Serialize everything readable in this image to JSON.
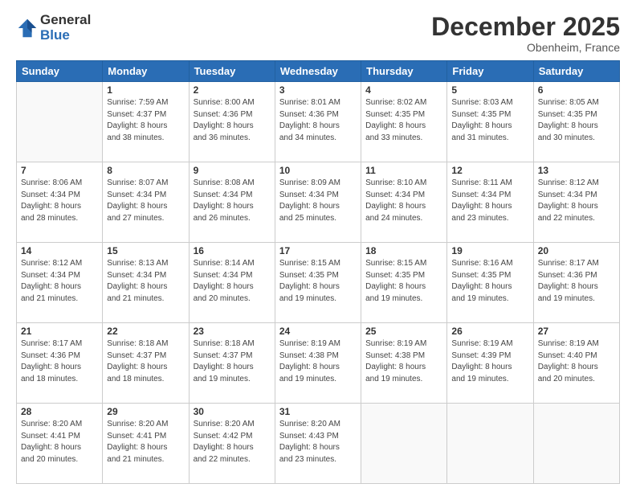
{
  "logo": {
    "general": "General",
    "blue": "Blue"
  },
  "header": {
    "month": "December 2025",
    "location": "Obenheim, France"
  },
  "days_of_week": [
    "Sunday",
    "Monday",
    "Tuesday",
    "Wednesday",
    "Thursday",
    "Friday",
    "Saturday"
  ],
  "weeks": [
    [
      {
        "num": "",
        "info": ""
      },
      {
        "num": "1",
        "info": "Sunrise: 7:59 AM\nSunset: 4:37 PM\nDaylight: 8 hours\nand 38 minutes."
      },
      {
        "num": "2",
        "info": "Sunrise: 8:00 AM\nSunset: 4:36 PM\nDaylight: 8 hours\nand 36 minutes."
      },
      {
        "num": "3",
        "info": "Sunrise: 8:01 AM\nSunset: 4:36 PM\nDaylight: 8 hours\nand 34 minutes."
      },
      {
        "num": "4",
        "info": "Sunrise: 8:02 AM\nSunset: 4:35 PM\nDaylight: 8 hours\nand 33 minutes."
      },
      {
        "num": "5",
        "info": "Sunrise: 8:03 AM\nSunset: 4:35 PM\nDaylight: 8 hours\nand 31 minutes."
      },
      {
        "num": "6",
        "info": "Sunrise: 8:05 AM\nSunset: 4:35 PM\nDaylight: 8 hours\nand 30 minutes."
      }
    ],
    [
      {
        "num": "7",
        "info": "Sunrise: 8:06 AM\nSunset: 4:34 PM\nDaylight: 8 hours\nand 28 minutes."
      },
      {
        "num": "8",
        "info": "Sunrise: 8:07 AM\nSunset: 4:34 PM\nDaylight: 8 hours\nand 27 minutes."
      },
      {
        "num": "9",
        "info": "Sunrise: 8:08 AM\nSunset: 4:34 PM\nDaylight: 8 hours\nand 26 minutes."
      },
      {
        "num": "10",
        "info": "Sunrise: 8:09 AM\nSunset: 4:34 PM\nDaylight: 8 hours\nand 25 minutes."
      },
      {
        "num": "11",
        "info": "Sunrise: 8:10 AM\nSunset: 4:34 PM\nDaylight: 8 hours\nand 24 minutes."
      },
      {
        "num": "12",
        "info": "Sunrise: 8:11 AM\nSunset: 4:34 PM\nDaylight: 8 hours\nand 23 minutes."
      },
      {
        "num": "13",
        "info": "Sunrise: 8:12 AM\nSunset: 4:34 PM\nDaylight: 8 hours\nand 22 minutes."
      }
    ],
    [
      {
        "num": "14",
        "info": "Sunrise: 8:12 AM\nSunset: 4:34 PM\nDaylight: 8 hours\nand 21 minutes."
      },
      {
        "num": "15",
        "info": "Sunrise: 8:13 AM\nSunset: 4:34 PM\nDaylight: 8 hours\nand 21 minutes."
      },
      {
        "num": "16",
        "info": "Sunrise: 8:14 AM\nSunset: 4:34 PM\nDaylight: 8 hours\nand 20 minutes."
      },
      {
        "num": "17",
        "info": "Sunrise: 8:15 AM\nSunset: 4:35 PM\nDaylight: 8 hours\nand 19 minutes."
      },
      {
        "num": "18",
        "info": "Sunrise: 8:15 AM\nSunset: 4:35 PM\nDaylight: 8 hours\nand 19 minutes."
      },
      {
        "num": "19",
        "info": "Sunrise: 8:16 AM\nSunset: 4:35 PM\nDaylight: 8 hours\nand 19 minutes."
      },
      {
        "num": "20",
        "info": "Sunrise: 8:17 AM\nSunset: 4:36 PM\nDaylight: 8 hours\nand 19 minutes."
      }
    ],
    [
      {
        "num": "21",
        "info": "Sunrise: 8:17 AM\nSunset: 4:36 PM\nDaylight: 8 hours\nand 18 minutes."
      },
      {
        "num": "22",
        "info": "Sunrise: 8:18 AM\nSunset: 4:37 PM\nDaylight: 8 hours\nand 18 minutes."
      },
      {
        "num": "23",
        "info": "Sunrise: 8:18 AM\nSunset: 4:37 PM\nDaylight: 8 hours\nand 19 minutes."
      },
      {
        "num": "24",
        "info": "Sunrise: 8:19 AM\nSunset: 4:38 PM\nDaylight: 8 hours\nand 19 minutes."
      },
      {
        "num": "25",
        "info": "Sunrise: 8:19 AM\nSunset: 4:38 PM\nDaylight: 8 hours\nand 19 minutes."
      },
      {
        "num": "26",
        "info": "Sunrise: 8:19 AM\nSunset: 4:39 PM\nDaylight: 8 hours\nand 19 minutes."
      },
      {
        "num": "27",
        "info": "Sunrise: 8:19 AM\nSunset: 4:40 PM\nDaylight: 8 hours\nand 20 minutes."
      }
    ],
    [
      {
        "num": "28",
        "info": "Sunrise: 8:20 AM\nSunset: 4:41 PM\nDaylight: 8 hours\nand 20 minutes."
      },
      {
        "num": "29",
        "info": "Sunrise: 8:20 AM\nSunset: 4:41 PM\nDaylight: 8 hours\nand 21 minutes."
      },
      {
        "num": "30",
        "info": "Sunrise: 8:20 AM\nSunset: 4:42 PM\nDaylight: 8 hours\nand 22 minutes."
      },
      {
        "num": "31",
        "info": "Sunrise: 8:20 AM\nSunset: 4:43 PM\nDaylight: 8 hours\nand 23 minutes."
      },
      {
        "num": "",
        "info": ""
      },
      {
        "num": "",
        "info": ""
      },
      {
        "num": "",
        "info": ""
      }
    ]
  ]
}
